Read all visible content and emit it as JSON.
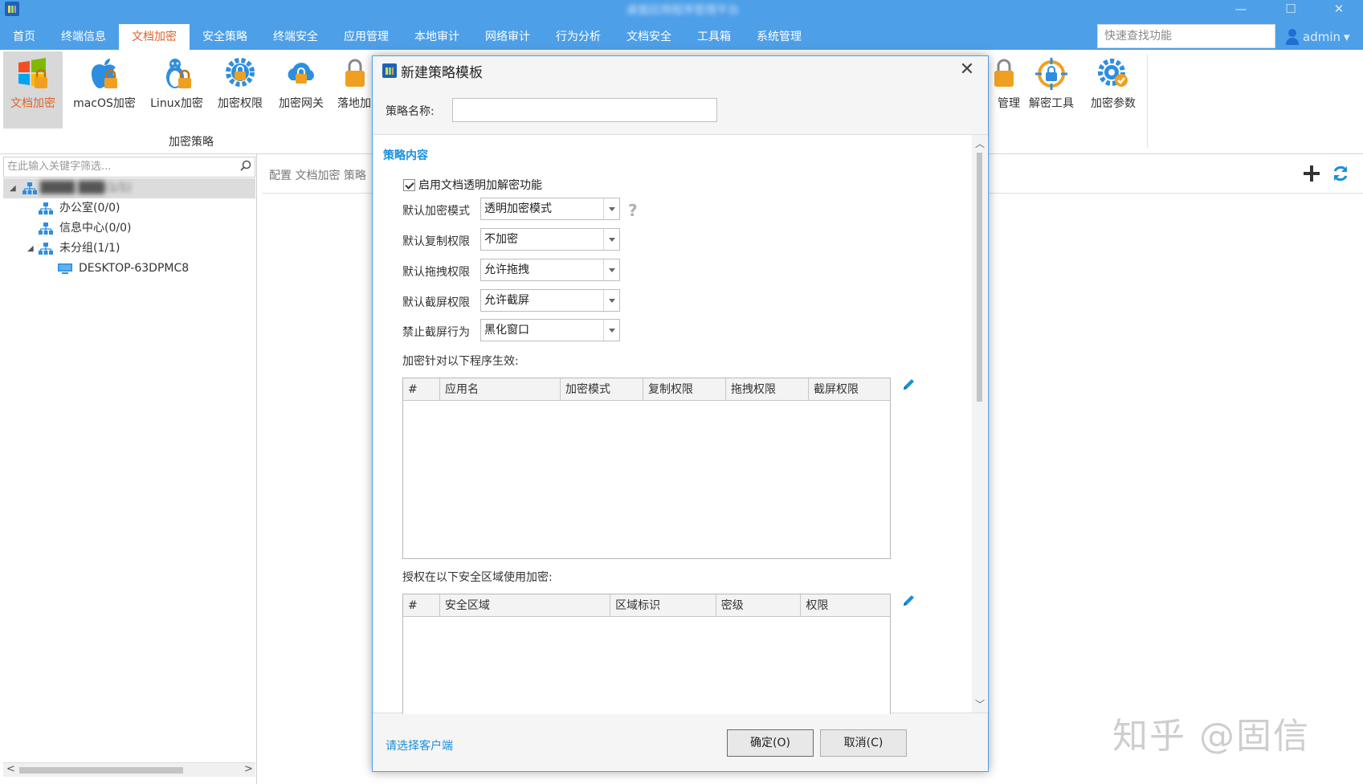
{
  "window": {
    "title": "桌面应用程序管理平台",
    "controls": [
      "—",
      "☐",
      "✕"
    ]
  },
  "menu": {
    "items": [
      "首页",
      "终端信息",
      "文档加密",
      "安全策略",
      "终端安全",
      "应用管理",
      "本地审计",
      "网络审计",
      "行为分析",
      "文档安全",
      "工具箱",
      "系统管理"
    ],
    "active_index": 2
  },
  "quick_search": {
    "placeholder": "快速查找功能"
  },
  "user": {
    "name": "admin",
    "caret": "▾"
  },
  "ribbon": {
    "buttons": [
      {
        "label": "文档加密",
        "icon": "windows-lock-icon"
      },
      {
        "label": "macOS加密",
        "icon": "apple-lock-icon"
      },
      {
        "label": "Linux加密",
        "icon": "linux-lock-icon"
      },
      {
        "label": "加密权限",
        "icon": "gear-lock-icon"
      },
      {
        "label": "加密网关",
        "icon": "cloud-lock-icon"
      },
      {
        "label": "落地加",
        "icon": "lock-icon"
      },
      {
        "label": "管理",
        "icon": "lock-icon"
      },
      {
        "label": "解密工具",
        "icon": "crosshair-lock-icon"
      },
      {
        "label": "加密参数",
        "icon": "gear-check-icon"
      }
    ],
    "group_label": "加密策略"
  },
  "left_panel": {
    "filter_placeholder": "在此输入关键字筛选...",
    "tree": [
      {
        "label": "████ ███(1/1)",
        "level": 0,
        "expanded": true,
        "type": "org",
        "blurred": true
      },
      {
        "label": "办公室(0/0)",
        "level": 1,
        "type": "org"
      },
      {
        "label": "信息中心(0/0)",
        "level": 1,
        "type": "org"
      },
      {
        "label": "未分组(1/1)",
        "level": 1,
        "expanded": true,
        "type": "org"
      },
      {
        "label": "DESKTOP-63DPMC8",
        "level": 2,
        "type": "pc"
      }
    ]
  },
  "main": {
    "breadcrumb": "配置 文档加密 策略"
  },
  "dialog": {
    "title": "新建策略模板",
    "close": "✕",
    "name_label": "策略名称:",
    "name_value": "",
    "section_title": "策略内容",
    "enable_checkbox": {
      "label": "启用文档透明加解密功能",
      "checked": true
    },
    "fields": [
      {
        "label": "默认加密模式",
        "value": "透明加密模式"
      },
      {
        "label": "默认复制权限",
        "value": "不加密"
      },
      {
        "label": "默认拖拽权限",
        "value": "允许拖拽"
      },
      {
        "label": "默认截屏权限",
        "value": "允许截屏"
      },
      {
        "label": "禁止截屏行为",
        "value": "黑化窗口"
      }
    ],
    "help_icon": "?",
    "programs_label": "加密针对以下程序生效:",
    "programs_columns": [
      "#",
      "应用名",
      "加密模式",
      "复制权限",
      "拖拽权限",
      "截屏权限"
    ],
    "zones_label": "授权在以下安全区域使用加密:",
    "zones_columns": [
      "#",
      "安全区域",
      "区域标识",
      "密级",
      "权限"
    ],
    "client_link": "请选择客户端",
    "ok": "确定(O)",
    "cancel": "取消(C)"
  },
  "watermark": "知乎 @固信",
  "colors": {
    "accent": "#4d9fe8",
    "active_menu_text": "#e0632a",
    "link": "#1a8fd8"
  }
}
